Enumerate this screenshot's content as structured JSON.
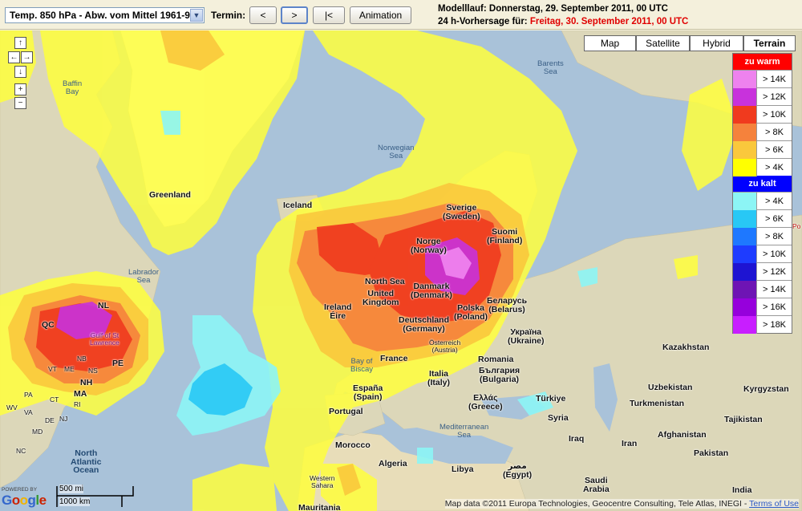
{
  "toolbar": {
    "product_select": "Temp. 850 hPa - Abw. vom Mittel 1961-90",
    "termin_label": "Termin:",
    "prev_label": "<",
    "next_label": ">",
    "first_label": "|<",
    "animation_label": "Animation",
    "model_run": "Modelllauf: Donnerstag, 29. September 2011, 00 UTC",
    "forecast_prefix": "24 h-Vorhersage für:",
    "forecast_date": "Freitag, 30. September 2011, 00 UTC"
  },
  "map_types": [
    "Map",
    "Satellite",
    "Hybrid",
    "Terrain"
  ],
  "map_type_selected": "Terrain",
  "legend": {
    "warm_title": "zu warm",
    "warm": [
      {
        "label": "> 14K",
        "color": "#ee82ee"
      },
      {
        "label": "> 12K",
        "color": "#c832dc"
      },
      {
        "label": "> 10K",
        "color": "#f03a1e"
      },
      {
        "label": "> 8K",
        "color": "#f5823c"
      },
      {
        "label": "> 6K",
        "color": "#fac83c"
      },
      {
        "label": "> 4K",
        "color": "#ffff00"
      }
    ],
    "cold_title": "zu kalt",
    "cold": [
      {
        "label": "> 4K",
        "color": "#8cf5f5"
      },
      {
        "label": "> 6K",
        "color": "#28c8f5"
      },
      {
        "label": "> 8K",
        "color": "#1e78ff"
      },
      {
        "label": "> 10K",
        "color": "#1e3cff"
      },
      {
        "label": "> 12K",
        "color": "#1e14d2"
      },
      {
        "label": "> 14K",
        "color": "#6e14b4"
      },
      {
        "label": "> 16K",
        "color": "#9600dc"
      },
      {
        "label": "> 18K",
        "color": "#c81eff"
      }
    ],
    "warm_header_color": "#ff0000",
    "cold_header_color": "#0000ff"
  },
  "labels": {
    "baffin_bay": "Baffin\nBay",
    "greenland": "Greenland",
    "barents_sea": "Barents\nSea",
    "norwegian_sea": "Norwegian\nSea",
    "iceland": "Iceland",
    "labrador_sea": "Labrador\nSea",
    "sverige": "Sverige\n(Sweden)",
    "suomi": "Suomi\n(Finland)",
    "norge": "Norge\n(Norway)",
    "north_sea": "North Sea",
    "danmark": "Danmark\n(Denmark)",
    "uk": "United\nKingdom",
    "ireland": "Ireland\nÉire",
    "polska": "Polska\n(Poland)",
    "belarus": "Беларусь\n(Belarus)",
    "deutschland": "Deutschland\n(Germany)",
    "ukraina": "Україна\n(Ukraine)",
    "osterreich": "Österreich\n(Austria)",
    "bay_biscay": "Bay of\nBiscay",
    "france": "France",
    "romania": "Romania",
    "bulgaria": "България\n(Bulgaria)",
    "espana": "España\n(Spain)",
    "italia": "Italia\n(Italy)",
    "portugal": "Portugal",
    "ellas": "Ελλάς\n(Greece)",
    "turkiye": "Türkiye",
    "kazakhstan": "Kazakhstan",
    "uzbekistan": "Uzbekistan",
    "turkmenistan": "Turkmenistan",
    "kyrgyzstan": "Kyrgyzstan",
    "tajikistan": "Tajikistan",
    "afghanistan": "Afghanistan",
    "pakistan": "Pakistan",
    "india": "India",
    "iraq": "Iraq",
    "iran": "Iran",
    "syria": "Syria",
    "mediterranean": "Mediterranean\nSea",
    "morocco": "Morocco",
    "algeria": "Algeria",
    "libya": "Libya",
    "misr": "مصر\n(Egypt)",
    "saudi": "Saudi\nArabia",
    "western_sahara": "Western\nSahara",
    "mauritania": "Mauritania",
    "north_atlantic": "North\nAtlantic\nOcean",
    "qc": "QC",
    "nl": "NL",
    "gulf": "Gulf of St\nLawrence",
    "pe": "PE",
    "nb": "NB",
    "ns": "NS",
    "me": "ME",
    "vt": "VT",
    "nh": "NH",
    "ma": "MA",
    "pa": "PA",
    "ct": "CT",
    "ri": "RI",
    "nj": "NJ",
    "de": "DE",
    "md": "MD",
    "va": "VA",
    "wv": "WV",
    "nc": "NC",
    "po": "Po"
  },
  "footer": {
    "powered_by": "POWERED BY",
    "google": "Google",
    "scale_mi": "500 mi",
    "scale_km": "1000 km",
    "credits": "Map data ©2011 Europa Technologies, Geocentre Consulting, Tele Atlas, INEGI -",
    "terms": "Terms of Use"
  }
}
